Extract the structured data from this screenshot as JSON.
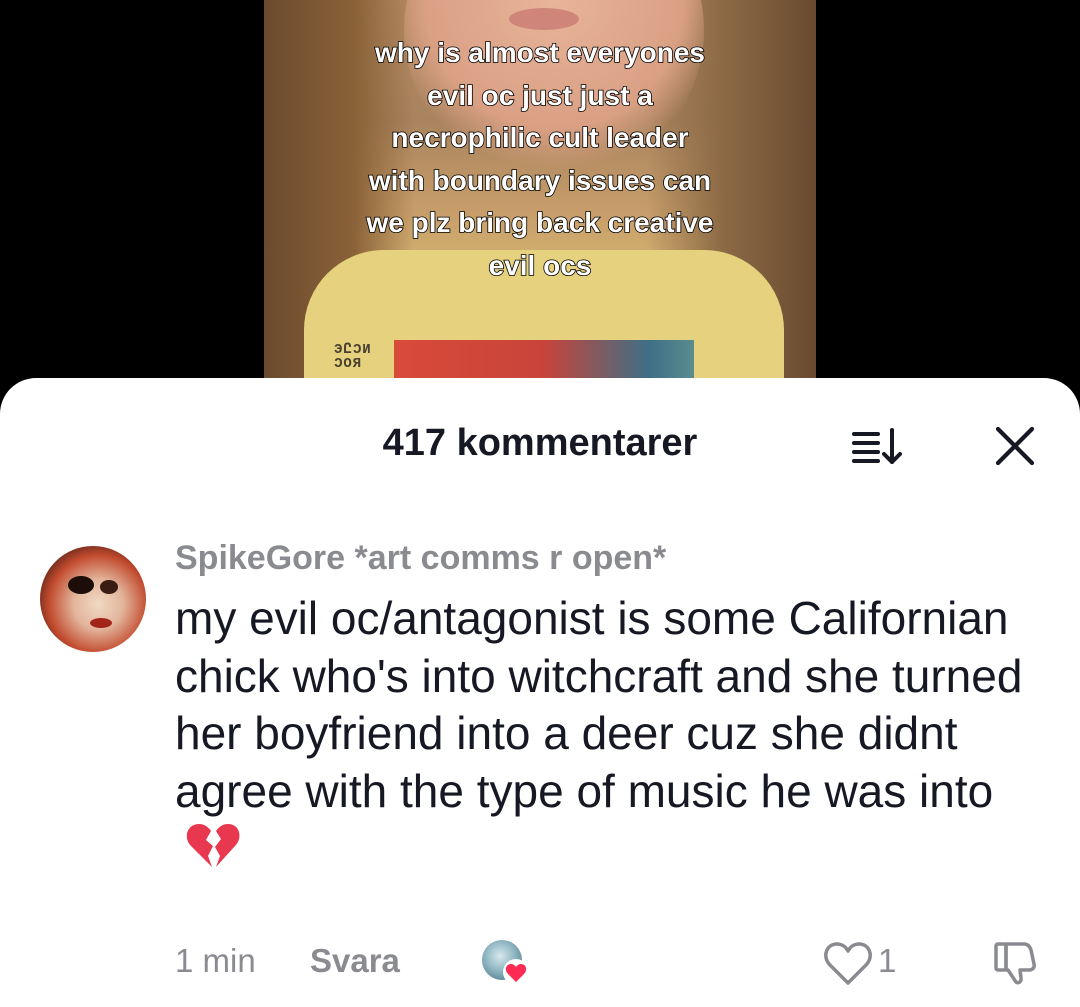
{
  "video": {
    "caption": "why is almost everyones\nevil oc just just a\nnecrophilic cult leader\nwith boundary issues can\nwe plz bring back creative\nevil ocs",
    "shirt_print_text": "ЭԸƆИ\nƆOЯ"
  },
  "comments_sheet": {
    "title": "417 kommentarer",
    "sort_icon": "sort-descending-icon",
    "close_icon": "close-icon"
  },
  "comment": {
    "username": "SpikeGore *art comms r open*",
    "text": "my evil oc/antagonist is some Californian chick who's into witchcraft and she turned her boyfriend into a deer cuz she didnt agree with the type of music he was into",
    "emoji": "broken-heart-icon",
    "time": "1 min",
    "reply_label": "Svara",
    "like_count": "1",
    "creator_liked": true
  },
  "colors": {
    "sheet_background": "#ffffff",
    "primary_text": "#161823",
    "secondary_text": "#8a8b91",
    "broken_heart": "#e8384f",
    "creator_heart": "#fe2c55"
  }
}
